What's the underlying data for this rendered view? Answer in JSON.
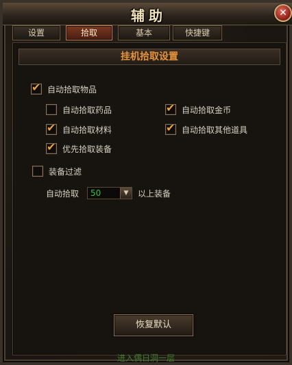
{
  "window": {
    "title": "辅助"
  },
  "tabs": [
    {
      "label": "设置"
    },
    {
      "label": "拾取"
    },
    {
      "label": "基本"
    },
    {
      "label": "快捷键"
    }
  ],
  "section": {
    "title": "挂机拾取设置"
  },
  "options": {
    "auto_pick_items": {
      "label": "自动拾取物品",
      "checked": true
    },
    "auto_pick_potions": {
      "label": "自动拾取药品",
      "checked": false
    },
    "auto_pick_gold": {
      "label": "自动拾取金币",
      "checked": true
    },
    "auto_pick_materials": {
      "label": "自动拾取材料",
      "checked": true
    },
    "auto_pick_other": {
      "label": "自动拾取其他道具",
      "checked": true
    },
    "priority_pick_equipment": {
      "label": "优先拾取装备",
      "checked": true
    },
    "equipment_filter": {
      "label": "装备过滤",
      "checked": false
    }
  },
  "level_filter": {
    "prefix": "自动拾取",
    "value": "50",
    "suffix": "以上装备"
  },
  "buttons": {
    "restore_default": "恢复默认"
  },
  "footer": {
    "text": "进入偶日洞一层"
  },
  "colors": {
    "accent": "#e8a040",
    "header_text": "#e7933a",
    "value_green": "#35c43a"
  }
}
